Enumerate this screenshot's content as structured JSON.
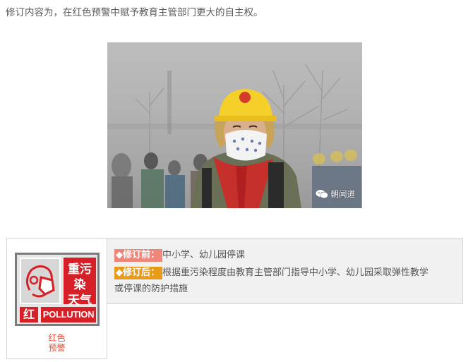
{
  "intro": {
    "text": "修订内容为，在红色预警中赋予教育主管部门更大的自主权。"
  },
  "photo": {
    "watermark": "朝闻道"
  },
  "alert_sign": {
    "line1": "重污染",
    "line2": "天气",
    "hong": "红",
    "pollution": "POLLUTION"
  },
  "alert_label": {
    "line1": "红色",
    "line2": "预警"
  },
  "revision": {
    "before_tag": "◆修订前：",
    "before_text": "中小学、幼儿园停课",
    "after_tag": "◆修订后：",
    "after_text_line1": "根据重污染程度由教育主管部门指导中小学、幼儿园采取弹性教学",
    "after_text_line2": "或停课的防护措施"
  },
  "colors": {
    "red": "#d61f27",
    "before_tag": "#f0857a",
    "after_tag": "#e89b19",
    "label": "#e04b2f"
  }
}
